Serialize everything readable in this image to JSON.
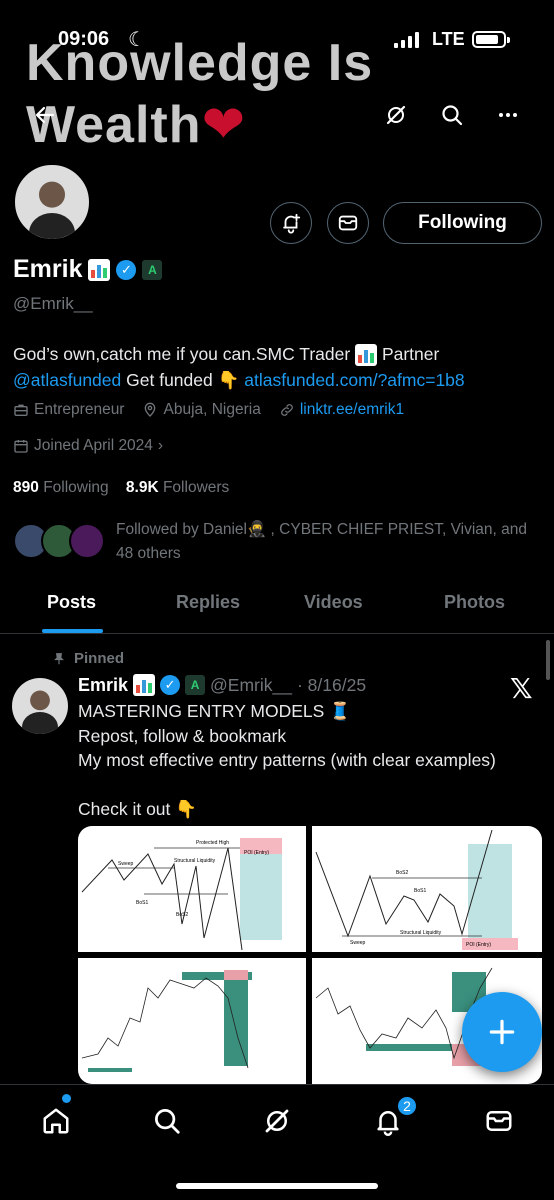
{
  "status_bar": {
    "time": "09:06",
    "network": "LTE"
  },
  "banner": {
    "line1": "Knowledge Is",
    "line2": "Wealth",
    "heart": "❤"
  },
  "topbar": {
    "back_icon": "arrow-left-icon",
    "grok_icon": "grok-icon",
    "search_icon": "search-icon",
    "more_icon": "more-icon"
  },
  "profile": {
    "name": "Emrik",
    "handle": "@Emrik__",
    "follow_button": "Following",
    "bio_line1": "God’s own,catch me if you can.SMC Trader",
    "bio_line1_end": "Partner",
    "bio_mention": "@atlasfunded",
    "bio_mid": "Get funded",
    "bio_link": "atlasfunded.com/?afmc=1b8",
    "occupation": "Entrepreneur",
    "location": "Abuja, Nigeria",
    "website": "linktr.ee/emrik1",
    "joined": "Joined April 2024",
    "following_count": "890",
    "following_label": "Following",
    "followers_count": "8.9K",
    "followers_label": "Followers",
    "followed_by": "Followed by Daniel🥷 , CYBER CHIEF PRIEST, Vivian, and 48 others"
  },
  "tabs": [
    {
      "label": "Posts",
      "active": true
    },
    {
      "label": "Replies",
      "active": false
    },
    {
      "label": "Videos",
      "active": false
    },
    {
      "label": "Photos",
      "active": false
    }
  ],
  "pinned_post": {
    "pinned_label": "Pinned",
    "author": "Emrik",
    "handle": "@Emrik__",
    "date": "· 8/16/25",
    "line1": "MASTERING ENTRY MODELS 🧵",
    "line2": "Repost, follow & bookmark",
    "line3": "My most effective entry patterns (with clear examples)",
    "line4": "Check it out 👇",
    "media_labels": {
      "a_protected_high": "Protected High",
      "a_sweep": "Sweep",
      "a_structural_liquidity": "Structural Liquidity",
      "a_poi": "POI (Entry)",
      "a_bos1": "BoS1",
      "a_bos2": "BoS2",
      "b_bos2": "BoS2",
      "b_bos1": "BoS1",
      "b_structural_liquidity": "Structural Liquidity",
      "b_sweep": "Sweep",
      "b_poi": "POI (Entry)"
    }
  },
  "bottom_nav": {
    "notification_count": "2"
  },
  "colors": {
    "accent": "#1d9bf0",
    "background": "#000000",
    "muted": "#71767b"
  }
}
